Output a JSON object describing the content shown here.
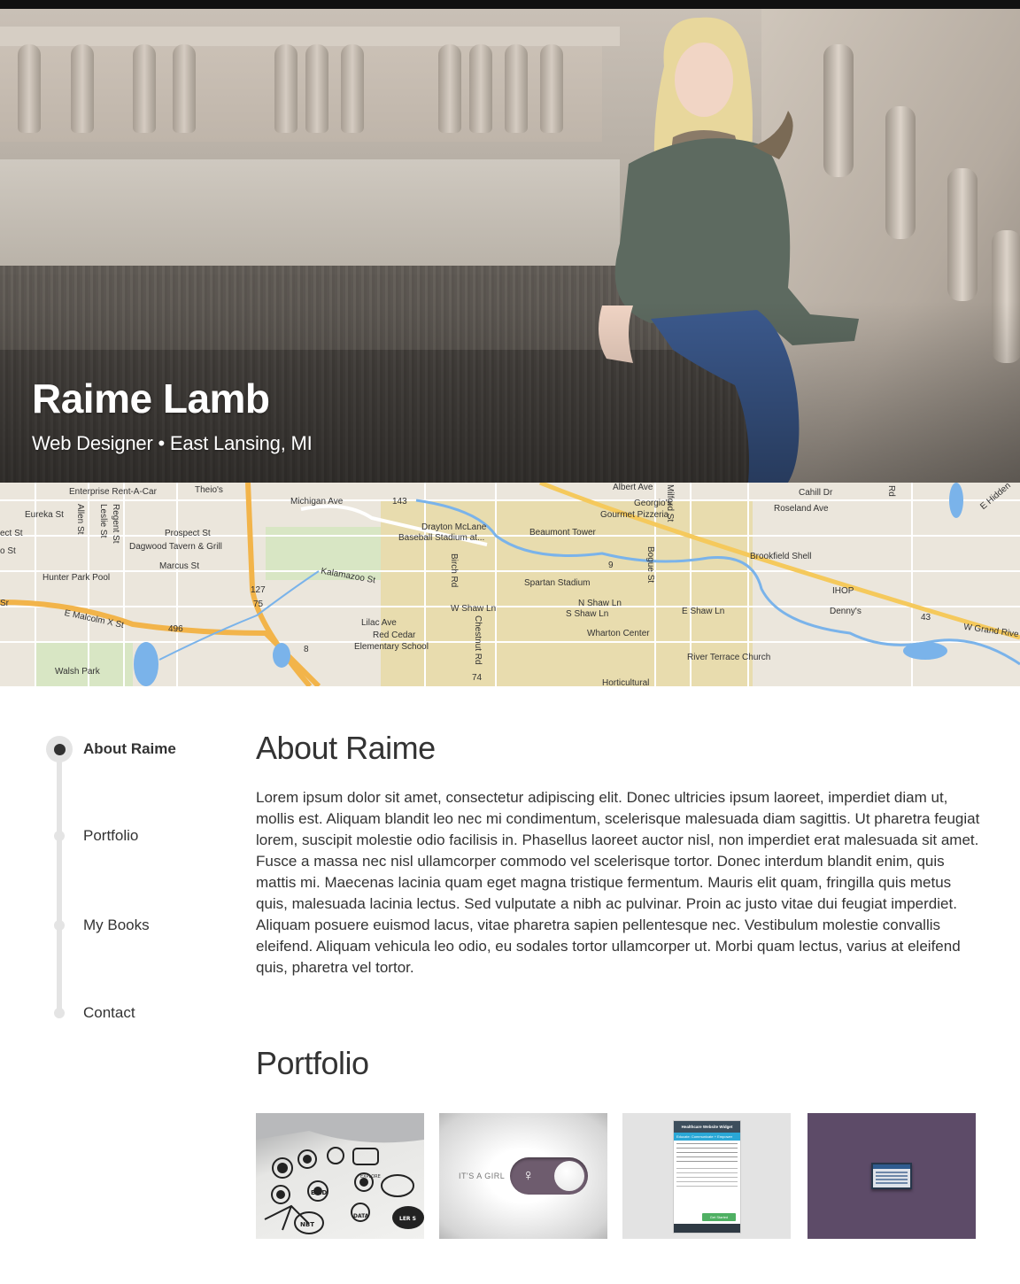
{
  "hero": {
    "name": "Raime Lamb",
    "subtitle": "Web Designer • East Lansing, MI"
  },
  "map": {
    "labels": [
      "Enterprise Rent-A-Car",
      "Theio's",
      "Michigan Ave",
      "143",
      "Albert Ave",
      "Georgio's",
      "Gourmet Pizzeria",
      "Milford St",
      "Cahill Dr",
      "Roseland Ave",
      "Eureka St",
      "Allen St",
      "Regent St",
      "Leslie St",
      "Prospect St",
      "Dagwood Tavern & Grill",
      "Marcus St",
      "Drayton McLane",
      "Baseball Stadium at...",
      "Beaumont Tower",
      "Brookfield Shell",
      "Kalamazoo St",
      "127",
      "Hunter Park Pool",
      "Spartan Stadium",
      "Birch Rd",
      "Bogue St",
      "9",
      "IHOP",
      "Denny's",
      "75",
      "W Shaw Ln",
      "N Shaw Ln",
      "S Shaw Ln",
      "E Shaw Ln",
      "43",
      "W Grand Rive",
      "E Malcolm X St",
      "496",
      "Lilac Ave",
      "Red Cedar",
      "Elementary School",
      "Chestnut Rd",
      "Wharton Center",
      "8",
      "River Terrace Church",
      "Walsh Park",
      "74",
      "Horticultural",
      "E Hidden",
      "ect St",
      "o St",
      "Sr",
      "Rd"
    ]
  },
  "nav": {
    "items": [
      {
        "label": "About Raime",
        "active": true
      },
      {
        "label": "Portfolio",
        "active": false
      },
      {
        "label": "My Books",
        "active": false
      },
      {
        "label": "Contact",
        "active": false
      }
    ]
  },
  "about": {
    "heading": "About Raime",
    "text": "Lorem ipsum dolor sit amet, consectetur adipiscing elit. Donec ultricies ipsum laoreet, imperdiet diam ut, mollis est. Aliquam blandit leo nec mi condimentum, scelerisque malesuada diam sagittis. Ut pharetra feugiat lorem, suscipit molestie odio facilisis in. Phasellus laoreet auctor nisl, non imperdiet erat malesuada sit amet. Fusce a massa nec nisl ullamcorper commodo vel scelerisque tortor. Donec interdum blandit enim, quis mattis mi. Maecenas lacinia quam eget magna tristique fermentum. Mauris elit quam, fringilla quis metus quis, malesuada lacinia lectus. Sed vulputate a nibh ac pulvinar. Proin ac justo vitae dui feugiat imperdiet. Aliquam posuere euismod lacus, vitae pharetra sapien pellentesque nec. Vestibulum molestie convallis eleifend. Aliquam vehicula leo odio, eu sodales tortor ullamcorper ut. Morbi quam lectus, varius at eleifend quis, pharetra vel tortor."
  },
  "portfolio": {
    "heading": "Portfolio",
    "items": [
      {
        "name": "sketches"
      },
      {
        "name": "toggle",
        "toggle_text": "IT'S A GIRL"
      },
      {
        "name": "widget",
        "widget_title": "Healthcare Website Widget",
        "widget_tab": "Educate: Communicate + Empower",
        "widget_button": "Get Started"
      },
      {
        "name": "screen"
      }
    ],
    "sketch_words": [
      "EXPLORE",
      "ECID",
      "NBT",
      "LER S",
      "DATA"
    ]
  },
  "colors": {
    "text": "#333333",
    "nav_track": "#e4e4e4",
    "accent_purple": "#5d4b68",
    "map_road": "#f2b44a",
    "map_water": "#7ab3ea",
    "map_campus": "#e6d9a8"
  }
}
